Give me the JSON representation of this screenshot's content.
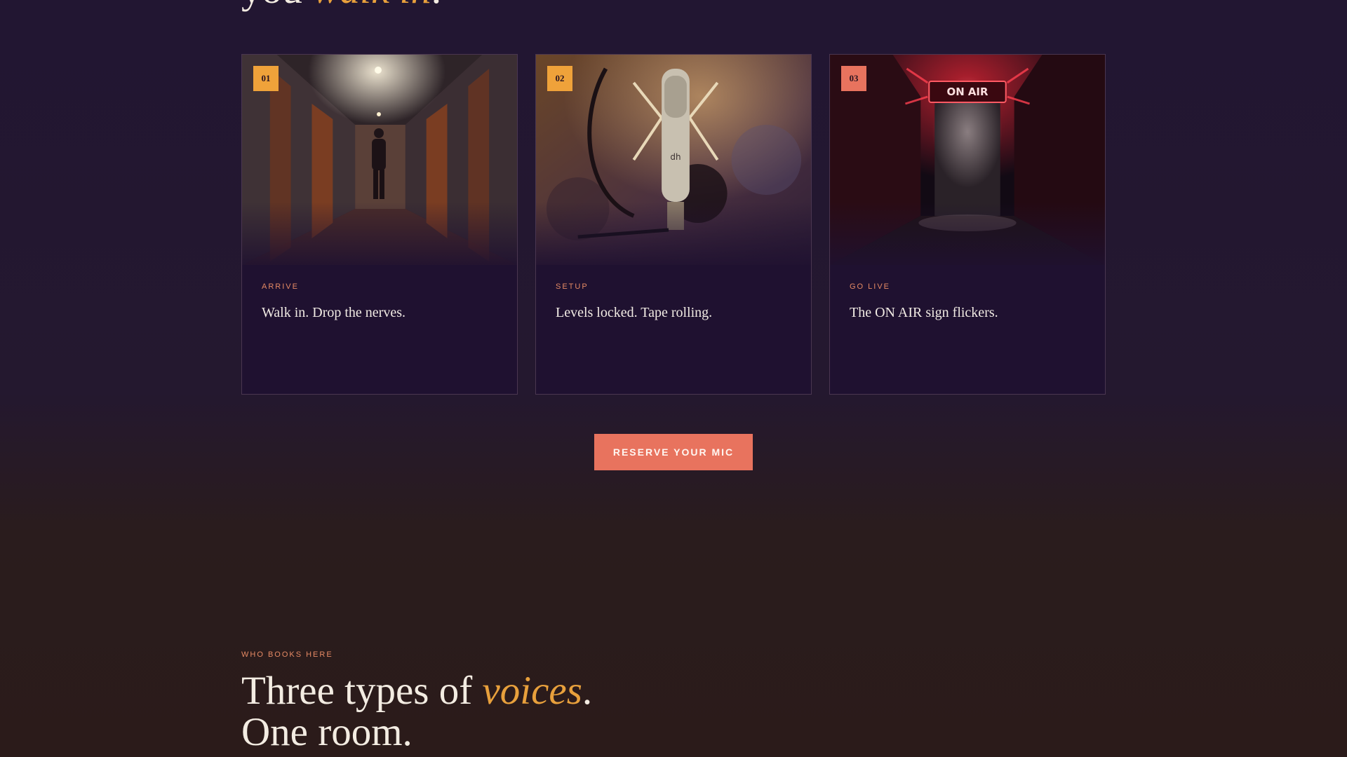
{
  "hero": {
    "heading_prefix": "you ",
    "heading_accent": "walk in",
    "heading_suffix": "."
  },
  "cards": [
    {
      "number": "01",
      "step": "ARRIVE",
      "text": "Walk in. Drop the nerves.",
      "badge_color": "#efa23a",
      "image": "studio-hallway-photo"
    },
    {
      "number": "02",
      "step": "SETUP",
      "text": "Levels locked. Tape rolling.",
      "badge_color": "#efa23a",
      "image": "condenser-microphone-photo"
    },
    {
      "number": "03",
      "step": "GO LIVE",
      "text": "The ON AIR sign flickers.",
      "badge_color": "#e8735e",
      "image": "on-air-door-photo",
      "sign_text": "ON AIR"
    }
  ],
  "cta": {
    "label": "RESERVE YOUR MIC"
  },
  "section": {
    "eyebrow": "WHO BOOKS HERE",
    "title_prefix": "Three types of ",
    "title_accent": "voices",
    "title_suffix": ".",
    "title_line2": "One room."
  },
  "colors": {
    "accent_gold": "#e8a03c",
    "accent_coral": "#e8735e",
    "background_top": "#221632",
    "background_bottom": "#2b1b1a"
  }
}
